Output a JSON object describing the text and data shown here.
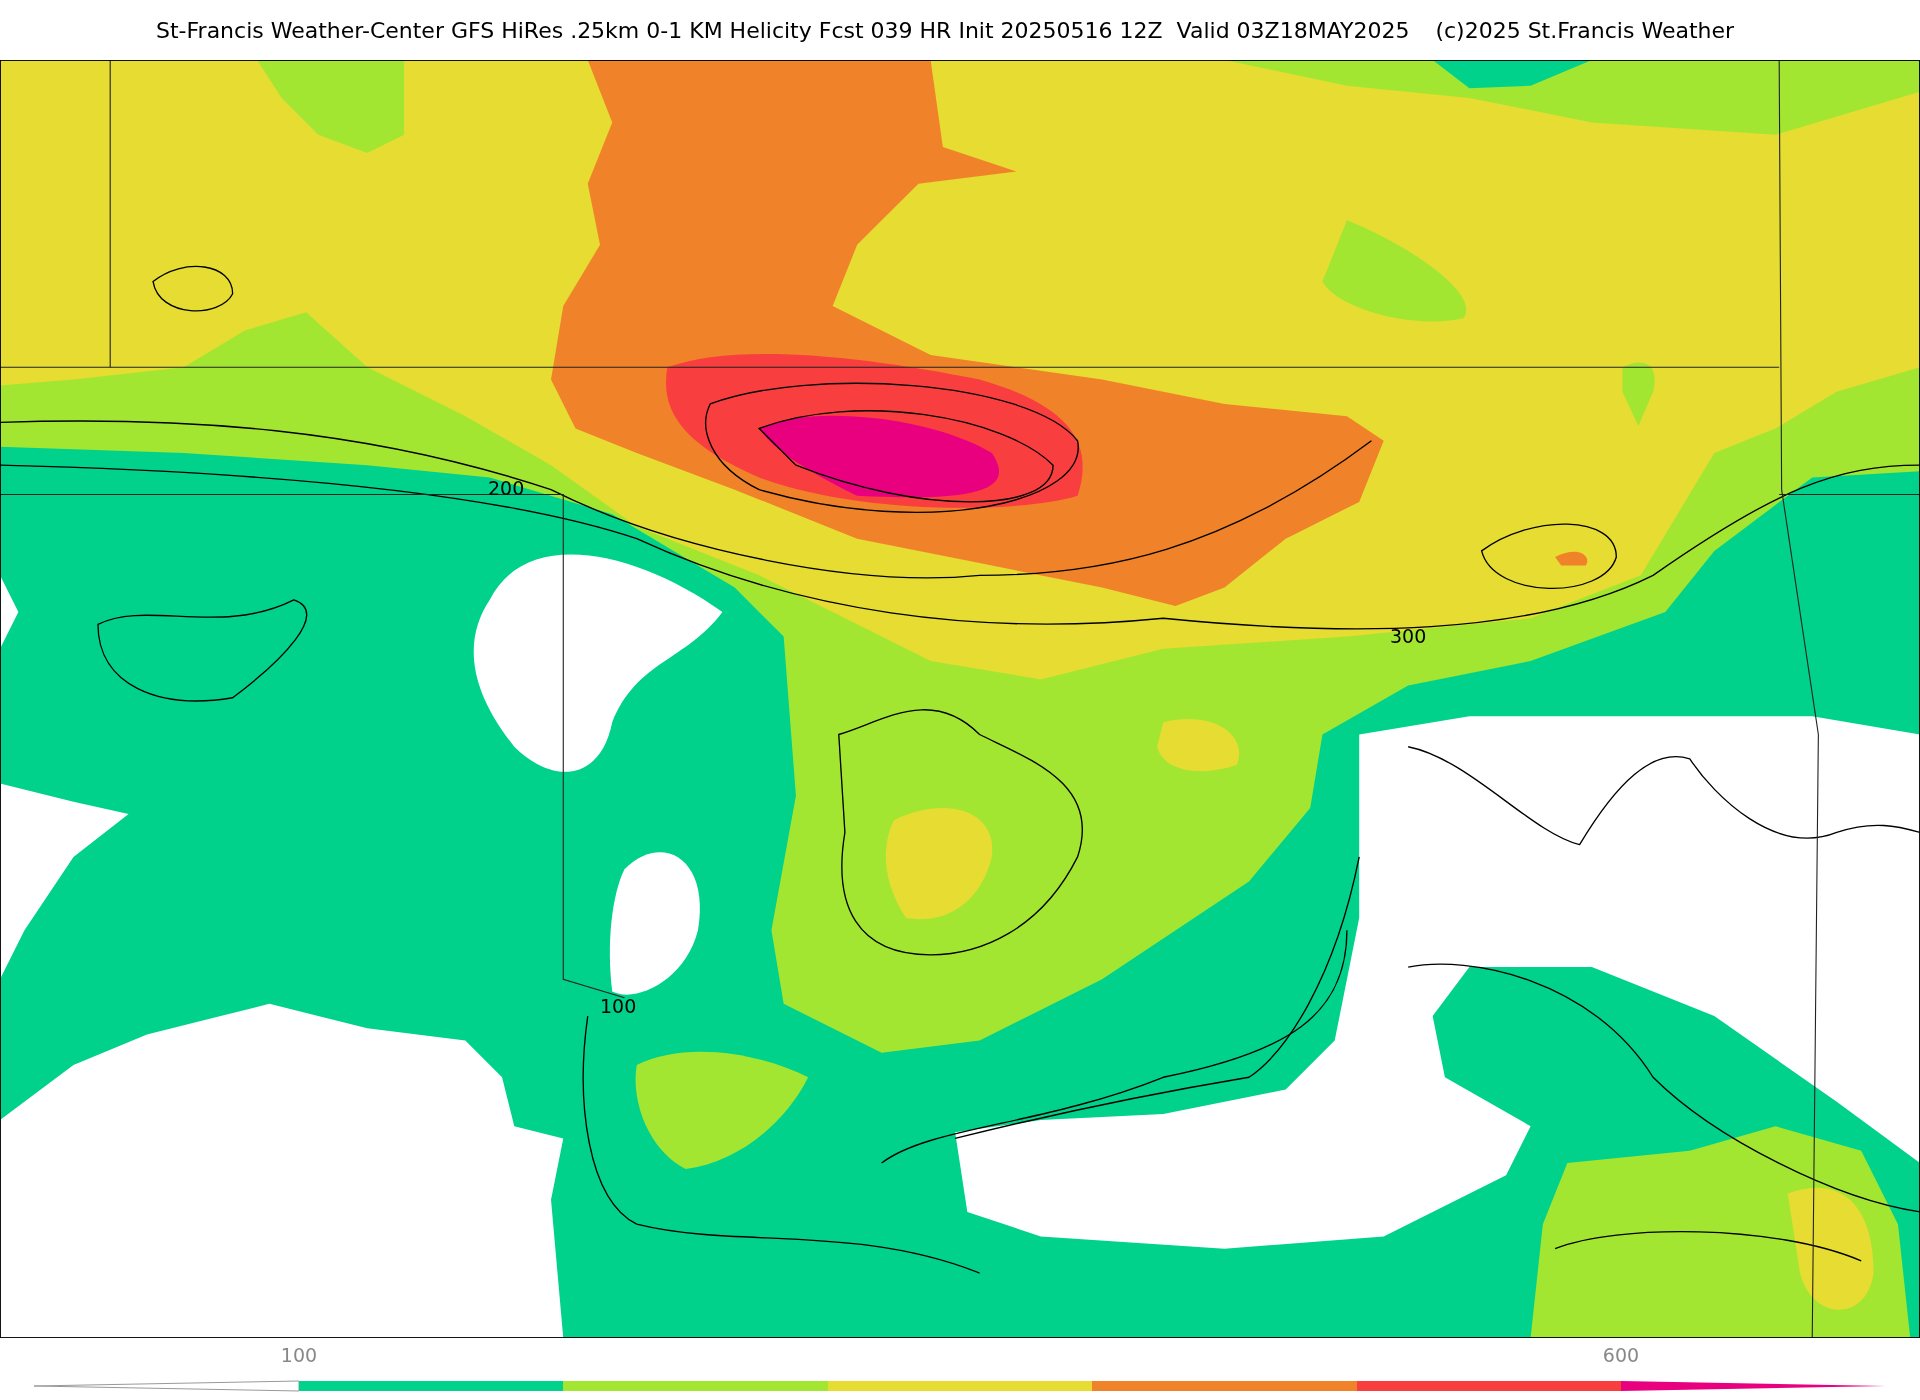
{
  "title": "St-Francis Weather-Center GFS HiRes .25km 0-1 KM Helicity Fcst 039 HR Init 20250516 12Z  Valid 03Z18MAY2025",
  "credit": "(c)2025 St.Francis Weather",
  "contour_labels": [
    "200",
    "300",
    "100"
  ],
  "colorbar": {
    "items": [
      {
        "kind": "under",
        "color": "#ffffff"
      },
      {
        "kind": "band",
        "color": "#00d28b"
      },
      {
        "kind": "band",
        "color": "#a3e632"
      },
      {
        "kind": "band",
        "color": "#e6dc32"
      },
      {
        "kind": "band",
        "color": "#f0822a"
      },
      {
        "kind": "band",
        "color": "#f83e3e"
      },
      {
        "kind": "over",
        "color": "#e8007f"
      }
    ],
    "ticks": [
      "100",
      "600"
    ]
  }
}
